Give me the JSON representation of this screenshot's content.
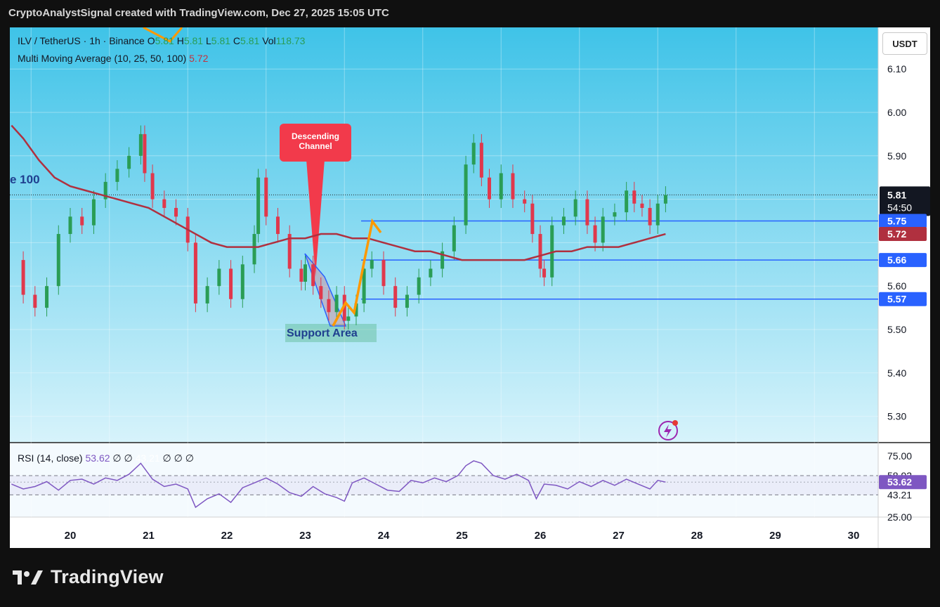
{
  "header": {
    "caption": "CryptoAnalystSignal created with TradingView.com, Dec 27, 2025 15:05 UTC"
  },
  "legend": {
    "symbol": "ILV / TetherUS · 1h · Binance",
    "o_label": "O",
    "o_value": "5.81",
    "h_label": "H",
    "h_value": "5.81",
    "l_label": "L",
    "l_value": "5.81",
    "c_label": "C",
    "c_value": "5.81",
    "vol_label": "Vol",
    "vol_value": "118.73",
    "ma_label": "Multi Moving Average (10, 25, 50, 100)",
    "ma_value": "5.72"
  },
  "currency_button": "USDT",
  "colors": {
    "bg_top": "#3fc3e8",
    "bg_bottom": "#d7f3fb",
    "candle_up": "#2a9d55",
    "candle_down": "#e0384c",
    "ma": "#b0303f",
    "level_line": "#2962ff",
    "rsi_line": "#7e57c2",
    "arrow": "#ff9800"
  },
  "annotations": {
    "ma_tag": "e 100",
    "descending_channel": "Descending Channel",
    "support_area": "Support Area"
  },
  "price_axis": {
    "ticks": [
      "6.10",
      "6.00",
      "5.90",
      "5.60",
      "5.50",
      "5.40",
      "5.30"
    ],
    "current_price": "5.81",
    "countdown": "54:50",
    "level_labels": [
      "5.75",
      "5.72",
      "5.66",
      "5.57"
    ]
  },
  "rsi": {
    "label": "RSI (14, close)",
    "value": "53.62",
    "extras": [
      "∅",
      "∅",
      "43.21",
      "∅",
      "∅",
      "∅"
    ],
    "axis_ticks": [
      "75.00",
      "58.92",
      "53.62",
      "43.21",
      "25.00"
    ]
  },
  "time_axis": {
    "labels": [
      "20",
      "21",
      "22",
      "23",
      "24",
      "25",
      "26",
      "27",
      "28",
      "29",
      "30"
    ]
  },
  "chart_data": {
    "type": "line",
    "title": "ILV / TetherUS · 1h · Binance",
    "ylim": [
      5.25,
      6.16
    ],
    "x_label_positions": {
      "20": 0,
      "21": 1,
      "22": 2,
      "23": 3,
      "24": 4,
      "25": 5,
      "26": 6,
      "27": 7,
      "28": 8,
      "29": 9,
      "30": 10
    },
    "series": [
      {
        "name": "ILV / TetherUS",
        "x": [
          -0.75,
          -0.6,
          -0.45,
          -0.3,
          -0.15,
          0.0,
          0.15,
          0.3,
          0.45,
          0.6,
          0.75,
          0.9,
          0.95,
          1.05,
          1.2,
          1.35,
          1.5,
          1.6,
          1.75,
          1.9,
          2.05,
          2.2,
          2.35,
          2.4,
          2.5,
          2.65,
          2.8,
          2.95,
          3.0,
          3.1,
          3.2,
          3.3,
          3.4,
          3.5,
          3.55,
          3.65,
          3.75,
          3.85,
          4.0,
          4.15,
          4.3,
          4.45,
          4.6,
          4.75,
          4.9,
          5.05,
          5.15,
          5.25,
          5.35,
          5.5,
          5.65,
          5.8,
          5.9,
          6.0,
          6.05,
          6.15,
          6.3,
          6.45,
          6.6,
          6.7,
          6.8,
          6.95,
          7.1,
          7.2,
          7.3,
          7.4,
          7.5,
          7.6
        ],
        "values": [
          5.66,
          5.58,
          5.55,
          5.6,
          5.72,
          5.76,
          5.74,
          5.8,
          5.84,
          5.87,
          5.9,
          5.95,
          5.86,
          5.8,
          5.78,
          5.76,
          5.7,
          5.56,
          5.6,
          5.64,
          5.57,
          5.65,
          5.72,
          5.85,
          5.76,
          5.72,
          5.64,
          5.61,
          5.65,
          5.6,
          5.57,
          5.54,
          5.58,
          5.52,
          5.53,
          5.56,
          5.64,
          5.66,
          5.6,
          5.55,
          5.58,
          5.62,
          5.64,
          5.68,
          5.74,
          5.88,
          5.93,
          5.85,
          5.8,
          5.86,
          5.8,
          5.79,
          5.72,
          5.64,
          5.62,
          5.74,
          5.76,
          5.8,
          5.74,
          5.7,
          5.76,
          5.77,
          5.82,
          5.79,
          5.78,
          5.74,
          5.79,
          5.81
        ]
      },
      {
        "name": "Multi Moving Average (10, 25, 50, 100)",
        "x": [
          -0.75,
          -0.6,
          -0.4,
          -0.2,
          0.0,
          0.2,
          0.4,
          0.6,
          0.8,
          1.0,
          1.2,
          1.4,
          1.6,
          1.8,
          2.0,
          2.2,
          2.4,
          2.6,
          2.8,
          3.0,
          3.2,
          3.4,
          3.6,
          3.8,
          4.0,
          4.2,
          4.4,
          4.6,
          4.8,
          5.0,
          5.2,
          5.4,
          5.6,
          5.8,
          6.0,
          6.2,
          6.4,
          6.6,
          6.8,
          7.0,
          7.2,
          7.4,
          7.6
        ],
        "values": [
          5.97,
          5.94,
          5.89,
          5.85,
          5.83,
          5.82,
          5.81,
          5.8,
          5.79,
          5.78,
          5.76,
          5.74,
          5.72,
          5.7,
          5.69,
          5.69,
          5.69,
          5.7,
          5.71,
          5.71,
          5.72,
          5.72,
          5.71,
          5.71,
          5.7,
          5.69,
          5.68,
          5.68,
          5.67,
          5.66,
          5.66,
          5.66,
          5.66,
          5.66,
          5.67,
          5.68,
          5.68,
          5.69,
          5.69,
          5.69,
          5.7,
          5.71,
          5.72
        ]
      }
    ],
    "levels": [
      5.75,
      5.66,
      5.57
    ],
    "rsi_ylim": [
      25,
      75
    ],
    "rsi_levels": [
      58.92,
      53.62,
      43.21
    ],
    "rsi_series": {
      "name": "RSI (14, close)",
      "x": [
        -0.75,
        -0.6,
        -0.45,
        -0.3,
        -0.15,
        0.0,
        0.15,
        0.3,
        0.45,
        0.6,
        0.75,
        0.9,
        1.05,
        1.2,
        1.35,
        1.5,
        1.6,
        1.75,
        1.9,
        2.05,
        2.2,
        2.35,
        2.5,
        2.65,
        2.8,
        2.95,
        3.1,
        3.25,
        3.4,
        3.5,
        3.6,
        3.75,
        3.9,
        4.05,
        4.2,
        4.35,
        4.5,
        4.65,
        4.8,
        4.95,
        5.05,
        5.15,
        5.25,
        5.4,
        5.55,
        5.7,
        5.85,
        5.95,
        6.05,
        6.2,
        6.35,
        6.5,
        6.65,
        6.8,
        6.95,
        7.1,
        7.25,
        7.4,
        7.5,
        7.6
      ],
      "values": [
        52,
        48,
        50,
        54,
        47,
        55,
        56,
        52,
        57,
        55,
        60,
        69,
        56,
        50,
        52,
        48,
        33,
        40,
        44,
        37,
        49,
        53,
        57,
        52,
        45,
        42,
        50,
        44,
        41,
        38,
        53,
        57,
        52,
        47,
        46,
        55,
        53,
        57,
        54,
        59,
        67,
        71,
        69,
        59,
        56,
        60,
        55,
        40,
        52,
        51,
        48,
        54,
        50,
        55,
        51,
        56,
        52,
        48,
        55,
        53.62
      ]
    }
  }
}
